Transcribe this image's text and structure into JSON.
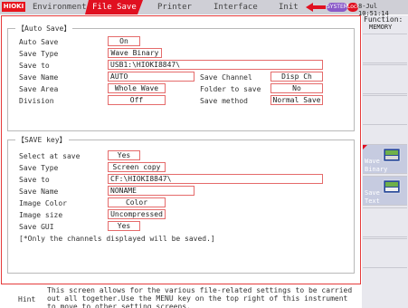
{
  "brand": "HIOKI",
  "tabs": [
    {
      "label": "Environment",
      "active": false
    },
    {
      "label": "File Save",
      "active": true
    },
    {
      "label": "Printer",
      "active": false
    },
    {
      "label": "Interface",
      "active": false
    },
    {
      "label": "Init",
      "active": false
    }
  ],
  "status": {
    "system_badge": "SYSTEM",
    "lock_badge": "Lock",
    "clock": "8-Jul 10:51:14"
  },
  "auto_save": {
    "title": "【Auto Save】",
    "auto_save_label": "Auto Save",
    "auto_save_value": "On",
    "save_type_label": "Save Type",
    "save_type_value": "Wave Binary",
    "save_to_label": "Save to",
    "save_to_value": "USB1:\\HIOKI8847\\",
    "save_name_label": "Save Name",
    "save_name_value": "AUTO",
    "save_channel_label": "Save Channel",
    "save_channel_value": "Disp Ch",
    "save_area_label": "Save Area",
    "save_area_value": "Whole Wave",
    "folder_label": "Folder to save",
    "folder_value": "No",
    "division_label": "Division",
    "division_value": "Off",
    "save_method_label": "Save method",
    "save_method_value": "Normal Save"
  },
  "save_key": {
    "title": "【SAVE key】",
    "select_label": "Select at save",
    "select_value": "Yes",
    "save_type_label": "Save Type",
    "save_type_value": "Screen copy",
    "save_to_label": "Save to",
    "save_to_value": "CF:\\HIOKI8847\\",
    "save_name_label": "Save Name",
    "save_name_value": "NONAME",
    "image_color_label": "Image Color",
    "image_color_value": "Color",
    "image_size_label": "Image size",
    "image_size_value": "Uncompressed",
    "save_gui_label": "Save GUI",
    "save_gui_value": "Yes",
    "note": "[*Only the channels displayed will be saved.]"
  },
  "hint": {
    "label": "Hint",
    "text": "This screen allows for the various file-related settings to be carried out all together.Use the MENU key on the top right of this instrument to move to other setting screens."
  },
  "function_panel": {
    "title": "Function:",
    "subtitle": "MEMORY",
    "keys": [
      {
        "line1": "Wave",
        "line2": "Binary",
        "key_no": "F1"
      },
      {
        "line1": "Save",
        "line2": "Text",
        "key_no": "F2"
      }
    ]
  },
  "colors": {
    "accent": "#e01020",
    "field_border": "#e56b6b",
    "panel_bg": "#e8e8ee"
  }
}
